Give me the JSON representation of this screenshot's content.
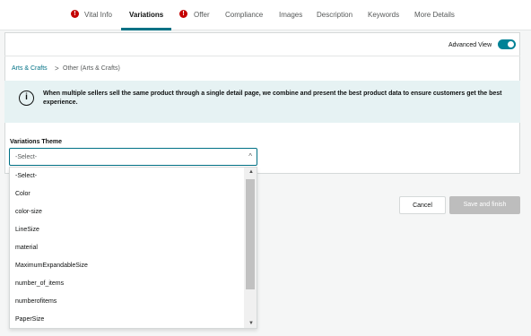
{
  "tabs": [
    {
      "label": "Vital Info",
      "error": true,
      "active": false
    },
    {
      "label": "Variations",
      "error": false,
      "active": true
    },
    {
      "label": "Offer",
      "error": true,
      "active": false
    },
    {
      "label": "Compliance",
      "error": false,
      "active": false
    },
    {
      "label": "Images",
      "error": false,
      "active": false
    },
    {
      "label": "Description",
      "error": false,
      "active": false
    },
    {
      "label": "Keywords",
      "error": false,
      "active": false
    },
    {
      "label": "More Details",
      "error": false,
      "active": false
    }
  ],
  "error_icon": "!",
  "advanced_view": {
    "label": "Advanced View",
    "enabled": true
  },
  "breadcrumb": {
    "parent": "Arts & Crafts",
    "separator": ">",
    "current": "Other (Arts & Crafts)"
  },
  "info": {
    "icon": "i",
    "text": "When multiple sellers sell the same product through a single detail page, we combine and present the best product data to ensure customers get the best experience."
  },
  "variations_theme": {
    "label": "Variations Theme",
    "selected": "-Select-",
    "options": [
      "-Select-",
      "Color",
      "color-size",
      "LineSize",
      "material",
      "MaximumExpandableSize",
      "number_of_items",
      "numberofitems",
      "PaperSize"
    ]
  },
  "buttons": {
    "cancel": "Cancel",
    "save": "Save and finish"
  },
  "colors": {
    "accent": "#007185",
    "toggle": "#008296",
    "error": "#c40000",
    "info_bg": "#e6f2f3"
  }
}
